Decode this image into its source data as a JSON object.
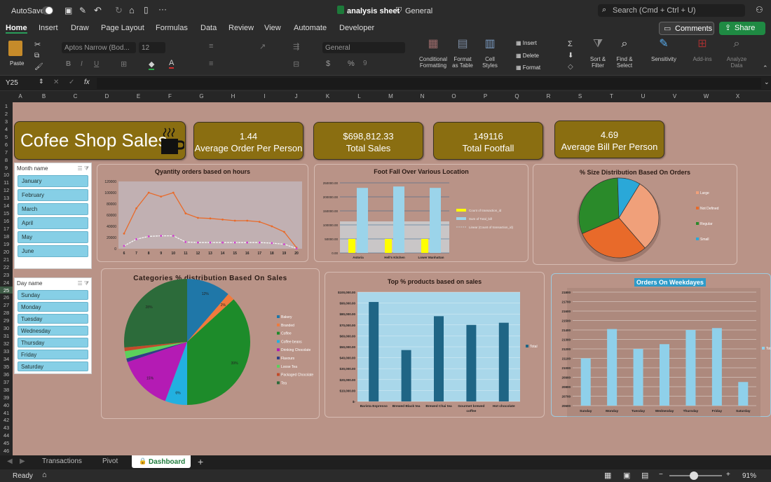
{
  "titlebar": {
    "autosave": "AutoSave",
    "filename": "analysis sheet",
    "sensitivity": "General",
    "search_placeholder": "Search (Cmd + Ctrl + U)"
  },
  "menu": [
    "Home",
    "Insert",
    "Draw",
    "Page Layout",
    "Formulas",
    "Data",
    "Review",
    "View",
    "Automate",
    "Developer"
  ],
  "comments_label": "Comments",
  "share_label": "Share",
  "ribbon": {
    "paste": "Paste",
    "font": "Aptos Narrow (Bod...",
    "font_size": "12",
    "number_format": "General",
    "cond_format": "Conditional\nFormatting",
    "format_table": "Format\nas Table",
    "cell_styles": "Cell\nStyles",
    "insert": "Insert",
    "delete": "Delete",
    "format": "Format",
    "sort_filter": "Sort &\nFilter",
    "find_select": "Find &\nSelect",
    "sensitivity": "Sensitivity",
    "addins": "Add-ins",
    "analyze": "Analyze\nData"
  },
  "namebox": "Y25",
  "fx": "fx",
  "columns": [
    "A",
    "B",
    "C",
    "D",
    "E",
    "F",
    "G",
    "H",
    "I",
    "J",
    "K",
    "L",
    "M",
    "N",
    "O",
    "P",
    "Q",
    "R",
    "S",
    "T",
    "U",
    "V",
    "W",
    "X"
  ],
  "dashboard": {
    "title": "Cofee Shop Sales",
    "kpis": [
      {
        "value": "1.44",
        "label": "Average Order Per Person"
      },
      {
        "value": "$698,812.33",
        "label": "Total Sales"
      },
      {
        "value": "149116",
        "label": "Total Footfall"
      },
      {
        "value": "4.69",
        "label": "Average Bill Per Person"
      }
    ],
    "month_slicer": {
      "title": "Month name",
      "items": [
        "January",
        "February",
        "March",
        "April",
        "May",
        "June"
      ]
    },
    "day_slicer": {
      "title": "Day name",
      "items": [
        "Sunday",
        "Monday",
        "Tuesday",
        "Wednesday",
        "Thursday",
        "Friday",
        "Saturday"
      ]
    }
  },
  "chart_data": [
    {
      "type": "line",
      "title": "Qyantity orders based on hours",
      "x": [
        6,
        7,
        8,
        9,
        10,
        11,
        12,
        13,
        14,
        15,
        16,
        17,
        18,
        19,
        20
      ],
      "ylim": [
        0,
        120000
      ],
      "yticks": [
        "0",
        "20000",
        "40000",
        "60000",
        "80000",
        "100000",
        "120000"
      ],
      "series": [
        {
          "values": [
            27000,
            72000,
            100000,
            93000,
            100000,
            63000,
            55000,
            54000,
            52000,
            50000,
            50000,
            48000,
            40000,
            30000,
            2000
          ],
          "color": "#e86a2a"
        },
        {
          "values": [
            5000,
            17000,
            22000,
            23000,
            23000,
            12000,
            11000,
            11000,
            11000,
            11000,
            11000,
            11000,
            10000,
            8000,
            500
          ],
          "color": "#f4f4f4"
        }
      ]
    },
    {
      "type": "bar",
      "title": "Foot Fall Over Various Location",
      "categories": [
        "Astoria",
        "Hell's Kitchen",
        "Lower Manhattan"
      ],
      "ylim": [
        0,
        250000
      ],
      "yticks": [
        "0.00",
        "50000.00",
        "100000.00",
        "150000.00",
        "200000.00",
        "250000.00"
      ],
      "series": [
        {
          "name": "Count of transaction_id",
          "values": [
            50000,
            50000,
            50000
          ],
          "color": "#ffff00"
        },
        {
          "name": "Sum of Total_bill",
          "values": [
            232000,
            237000,
            232000
          ],
          "color": "#9bd4ea"
        },
        {
          "name": "Linear (Count of transaction_id)",
          "color": "#cccccc"
        }
      ]
    },
    {
      "type": "pie",
      "title": "% Size Distribution Based On Orders",
      "labels": [
        "Large",
        "Not Defined",
        "Regular",
        "Small"
      ],
      "values": [
        29,
        29,
        30,
        9
      ],
      "colors": [
        "#f0a07a",
        "#e86a2a",
        "#2a8a2a",
        "#2aa8d8"
      ]
    },
    {
      "type": "pie",
      "title": "Categories % distribution Based On Sales",
      "labels": [
        "Bakery",
        "Branded",
        "Coffee",
        "Coffee beans",
        "Drinking Chocolate",
        "Flavours",
        "Loose Tea",
        "Packaged Chocolate",
        "Tea"
      ],
      "values": [
        12,
        2,
        39,
        6,
        15,
        1,
        2,
        1,
        28
      ],
      "data_labels": [
        "12%",
        "2%",
        "39%",
        "6%",
        "15%",
        "",
        "",
        "",
        "28%"
      ],
      "colors": [
        "#1f77a8",
        "#f07a3c",
        "#1d8b2a",
        "#22b0e0",
        "#b41bb4",
        "#2f3f86",
        "#5bd15b",
        "#c24b2a",
        "#2c6b3a"
      ]
    },
    {
      "type": "bar",
      "title": "Top % products based on sales",
      "categories": [
        "Barista Espresso",
        "Brewed Black tea",
        "Brewed Chai tea",
        "Gourmet brewed coffee",
        "Hot chocolate"
      ],
      "values": [
        91000,
        47000,
        78000,
        70000,
        72000
      ],
      "ylim": [
        0,
        100000
      ],
      "yticks": [
        "$-",
        "$10,000.00",
        "$20,000.00",
        "$30,000.00",
        "$40,000.00",
        "$50,000.00",
        "$60,000.00",
        "$70,000.00",
        "$80,000.00",
        "$90,000.00",
        "$100,000.00"
      ],
      "series": [
        {
          "name": "Total"
        }
      ]
    },
    {
      "type": "bar",
      "title": "Orders On Weekdayes",
      "categories": [
        "Sunday",
        "Monday",
        "Tuesday",
        "Wednesday",
        "Thursday",
        "Friday",
        "Saturday"
      ],
      "values": [
        21100,
        21410,
        21200,
        21250,
        21400,
        21420,
        20850
      ],
      "ylim": [
        20600,
        21800
      ],
      "yticks": [
        "20600",
        "20700",
        "20800",
        "20900",
        "21000",
        "21100",
        "21200",
        "21300",
        "21400",
        "21500",
        "21600",
        "21700",
        "21800"
      ],
      "series": [
        {
          "name": "Total"
        }
      ]
    }
  ],
  "sheet_tabs": [
    "Transactions",
    "Pivot",
    "Dashboard"
  ],
  "status": {
    "ready": "Ready",
    "zoom": "91%"
  }
}
